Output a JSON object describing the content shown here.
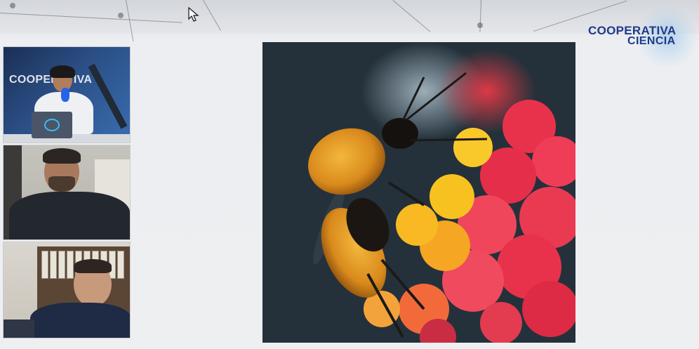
{
  "brand": {
    "line1": "COOPERATIVA",
    "line2": "CIENCIA",
    "color": "#1e3a8a"
  },
  "participants": [
    {
      "role": "host",
      "overlay_text": "COOPERATIVA"
    },
    {
      "role": "guest-1"
    },
    {
      "role": "guest-2"
    }
  ],
  "shared_image": {
    "subject": "bumblebee-on-flower"
  },
  "icons": {
    "cursor": "mouse-pointer-icon",
    "logo": "cooperativa-ciencia-logo"
  }
}
